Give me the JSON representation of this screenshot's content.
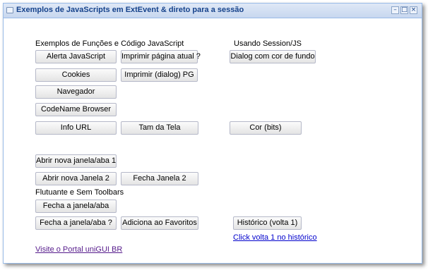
{
  "window": {
    "title": "Exemplos de JavaScripts em ExtEvent & direto para a sessão",
    "tools": {
      "minimize": "–",
      "maximize": "□",
      "close": "×"
    }
  },
  "sections": {
    "functions_label": "Exemplos de Funções e Código JavaScript",
    "session_label": "Usando Session/JS",
    "floating_label": "Flutuante e Sem Toolbars"
  },
  "buttons": {
    "alerta": "Alerta JavaScript",
    "imprimir_pagina": "Imprimir página atual ?",
    "dialog_cor": "Dialog com cor de fundo",
    "cookies": "Cookies",
    "imprimir_dialog": "Imprimir (dialog) PG",
    "navegador": "Navegador",
    "codename": "CodeName Browser",
    "info_url": "Info URL",
    "tam_tela": "Tam da Tela",
    "cor_bits": "Cor (bits)",
    "abrir_nova_1": "Abrir nova janela/aba 1",
    "abrir_nova_2": "Abrir nova Janela 2",
    "fecha_janela_2": "Fecha Janela 2",
    "fecha_janela_aba": "Fecha a janela/aba",
    "fecha_janela_aba_q": "Fecha a janela/aba ?",
    "adiciona_favoritos": "Adiciona ao Favoritos",
    "historico": "Histórico (volta 1)"
  },
  "links": {
    "click_volta": "Click volta 1 no histórico",
    "visite_portal": "Visite o Portal uniGUI BR"
  },
  "colors": {
    "title_text": "#15428b",
    "link_blue": "#0000cc",
    "link_visited": "#551a8b"
  }
}
